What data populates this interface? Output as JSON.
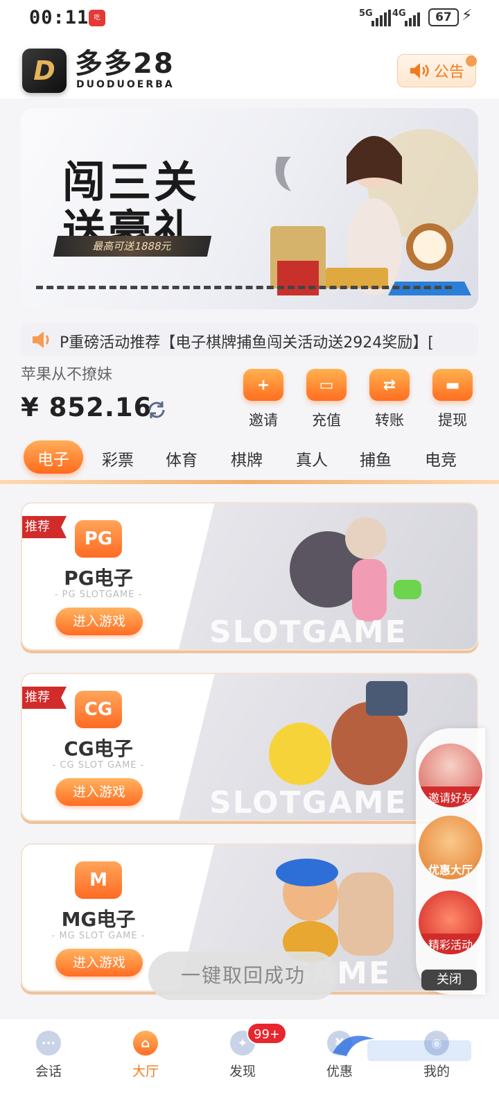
{
  "status_bar": {
    "time": "00:11",
    "notif": "吃",
    "net1": "5G",
    "net2": "4G",
    "battery": "67"
  },
  "header": {
    "logo_letter": "D",
    "brand": "多多28",
    "brand_sub": "DUODUOERBA",
    "notice_label": "公告"
  },
  "banner": {
    "line1": "闯三关",
    "line2": "送豪礼",
    "subtitle": "最高可送1888元"
  },
  "marquee": {
    "text": "P重磅活动推荐【电子棋牌捕鱼闯关活动送2924奖励】["
  },
  "user": {
    "name": "苹果从不撩妹",
    "balance": "¥ 852.16"
  },
  "actions": [
    {
      "label": "邀请",
      "icon": "invite-icon",
      "glyph": "+"
    },
    {
      "label": "充值",
      "icon": "wallet-icon",
      "glyph": "▭"
    },
    {
      "label": "转账",
      "icon": "transfer-icon",
      "glyph": "⇄"
    },
    {
      "label": "提现",
      "icon": "card-icon",
      "glyph": "▬"
    }
  ],
  "tabs": [
    "电子",
    "彩票",
    "体育",
    "棋牌",
    "真人",
    "捕鱼",
    "电竞"
  ],
  "active_tab": "电子",
  "games": [
    {
      "tag": "推荐",
      "icon_text": "PG",
      "name": "PG电子",
      "sub": "- PG SLOTGAME -",
      "button": "进入游戏",
      "watermark": "SLOTGAME"
    },
    {
      "tag": "推荐",
      "icon_text": "CG",
      "name": "CG电子",
      "sub": "- CG SLOT GAME -",
      "button": "进入游戏",
      "watermark": "SLOTGAME"
    },
    {
      "tag": "",
      "icon_text": "M",
      "name": "MG电子",
      "sub": "- MG SLOT GAME -",
      "button": "进入游戏",
      "watermark": "GAME"
    }
  ],
  "floating": {
    "items": [
      "邀请好友",
      "优惠大厅",
      "精彩活动"
    ],
    "close": "关闭"
  },
  "toast": "一键取回成功",
  "nav": {
    "items": [
      {
        "label": "会话",
        "icon": "chat-icon",
        "glyph": "···"
      },
      {
        "label": "大厅",
        "icon": "hall-icon",
        "glyph": "⌂"
      },
      {
        "label": "发现",
        "icon": "discover-icon",
        "glyph": "✦"
      },
      {
        "label": "优惠",
        "icon": "promo-icon",
        "glyph": "¥"
      },
      {
        "label": "我的",
        "icon": "profile-icon",
        "glyph": "◉"
      }
    ],
    "badge": "99+"
  },
  "colors": {
    "accent": "#ff6a1c",
    "accent_light": "#ffae5a",
    "tag_red": "#d12b2b",
    "badge_red": "#e8262d"
  }
}
